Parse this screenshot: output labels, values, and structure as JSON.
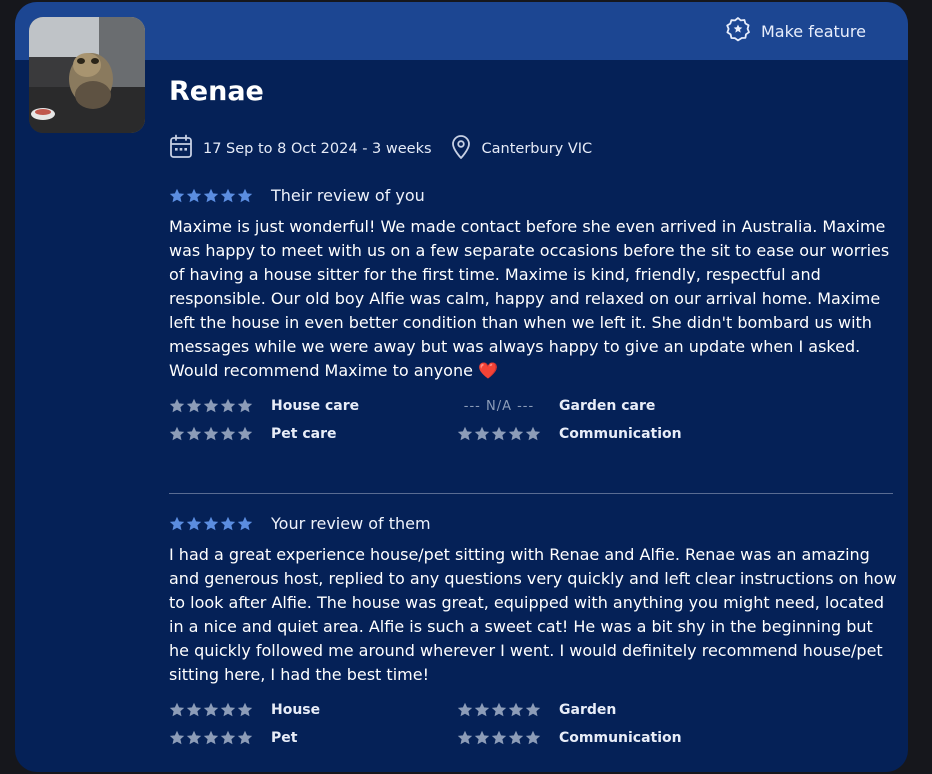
{
  "header": {
    "feature_label": "Make feature"
  },
  "profile": {
    "name": "Renae",
    "dates": "17 Sep to 8 Oct 2024 - 3 weeks",
    "location": "Canterbury VIC"
  },
  "their_review": {
    "title": "Their review of you",
    "rating": 5,
    "text": "Maxime is just wonderful! We made contact before she even arrived in Australia. Maxime was happy to meet with us on a few separate occasions before the sit to ease our worries of having a house sitter for the first time. Maxime is kind, friendly, respectful and responsible. Our old boy Alfie was calm, happy and relaxed on our arrival home. Maxime left the house in even better condition than when we left it. She didn't bombard us with messages while we were away but was always happy to give an update when I asked. Would recommend Maxime to anyone",
    "emoji": "❤️",
    "ratings": [
      {
        "label": "House care",
        "stars": 5
      },
      {
        "label": "Garden care",
        "na": "--- N/A ---"
      },
      {
        "label": "Pet care",
        "stars": 5
      },
      {
        "label": "Communication",
        "stars": 5
      }
    ]
  },
  "your_review": {
    "title": "Your review of them",
    "rating": 5,
    "text": "I had a great experience house/pet sitting with Renae and Alfie. Renae was an amazing and generous host, replied to any questions very quickly and left clear instructions on how to look after Alfie. The house was great, equipped with anything you might need, located in a nice and quiet area. Alfie is such a sweet cat! He was a bit shy in the beginning but he quickly followed me around wherever I went. I would definitely recommend house/pet sitting here, I had the best time!",
    "ratings": [
      {
        "label": "House",
        "stars": 5
      },
      {
        "label": "Garden",
        "stars": 5
      },
      {
        "label": "Pet",
        "stars": 5
      },
      {
        "label": "Communication",
        "stars": 5
      }
    ]
  },
  "colors": {
    "card_bg": "#052157",
    "topbar_bg": "#1c4692",
    "star_accent": "#5b8de0",
    "star_muted": "#8c9cb8",
    "heart": "#e0262f"
  }
}
